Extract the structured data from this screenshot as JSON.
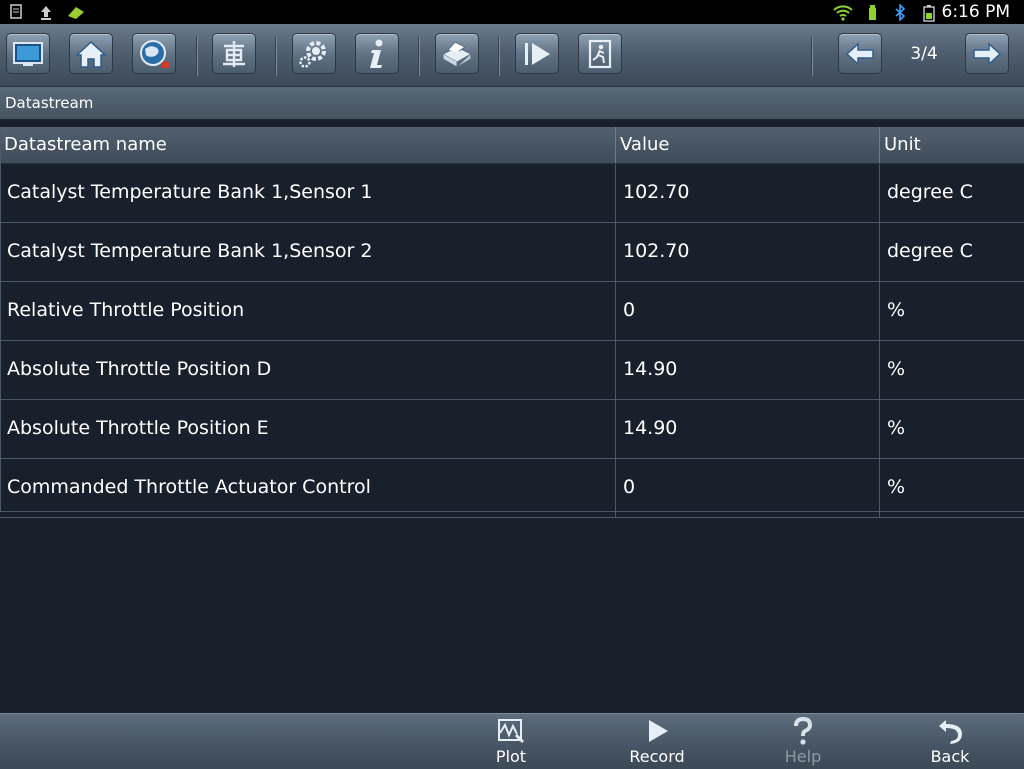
{
  "status_bar": {
    "time": "6:16 PM"
  },
  "toolbar": {
    "page_indicator": "3/4"
  },
  "breadcrumb": {
    "title": "Datastream"
  },
  "table": {
    "headers": [
      "Datastream name",
      "Value",
      "Unit"
    ],
    "rows": [
      {
        "name": "Catalyst Temperature Bank 1,Sensor 1",
        "value": "102.70",
        "unit": "degree C"
      },
      {
        "name": "Catalyst Temperature Bank 1,Sensor 2",
        "value": "102.70",
        "unit": "degree C"
      },
      {
        "name": "Relative Throttle Position",
        "value": "0",
        "unit": "%"
      },
      {
        "name": "Absolute Throttle Position D",
        "value": "14.90",
        "unit": "%"
      },
      {
        "name": "Absolute Throttle Position E",
        "value": "14.90",
        "unit": "%"
      },
      {
        "name": "Commanded Throttle Actuator Control",
        "value": "0",
        "unit": "%"
      }
    ]
  },
  "bottom_bar": {
    "plot_label": "Plot",
    "record_label": "Record",
    "help_label": "Help",
    "back_label": "Back"
  }
}
